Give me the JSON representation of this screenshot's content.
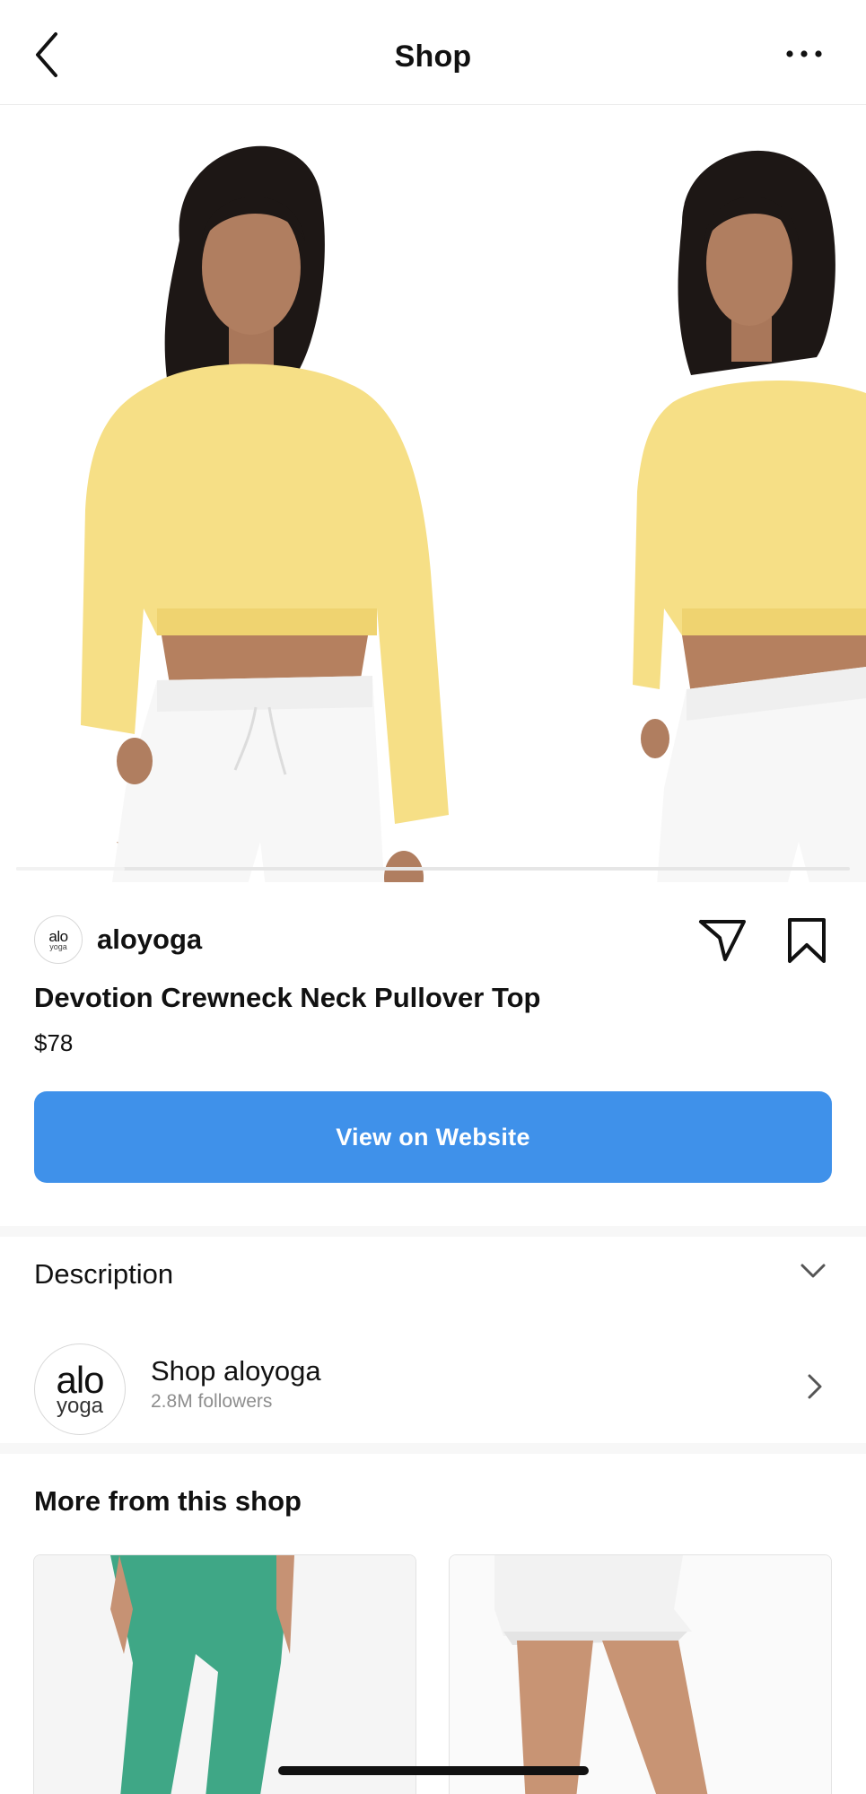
{
  "header": {
    "title": "Shop"
  },
  "carousel": {
    "image_count_visible": 2,
    "progress": 0.13
  },
  "product": {
    "brand": {
      "name": "aloyoga",
      "logo_line1": "alo",
      "logo_line2": "yoga"
    },
    "title": "Devotion Crewneck Neck Pullover Top",
    "price": "$78",
    "cta_label": "View on Website"
  },
  "description": {
    "label": "Description"
  },
  "shop": {
    "name": "Shop aloyoga",
    "followers": "2.8M followers",
    "logo_line1": "alo",
    "logo_line2": "yoga"
  },
  "more_from_shop": {
    "title": "More from this shop",
    "items": [
      {
        "image": "green leggings"
      },
      {
        "image": "white pleated skirt"
      }
    ]
  },
  "colors": {
    "accent": "#3f91ea",
    "sweater": "#f6df86",
    "leggings": "#3fa786",
    "secondary_text": "#8e8e8e"
  },
  "icons": [
    "back-icon",
    "more-icon",
    "share-icon",
    "bookmark-icon",
    "chevron-down-icon",
    "chevron-right-icon"
  ]
}
